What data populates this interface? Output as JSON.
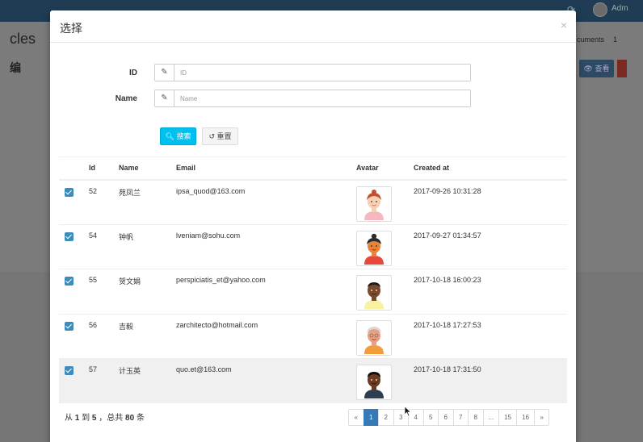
{
  "background": {
    "user_name": "Adm",
    "page_title": "cles",
    "page_subtitle": "编",
    "crumb": "cuments",
    "crumb_num": "1",
    "view_button": "查看"
  },
  "modal": {
    "title": "选择",
    "close": "×"
  },
  "filters": {
    "id_label": "ID",
    "id_placeholder": "ID",
    "name_label": "Name",
    "name_placeholder": "Name",
    "search_button": "搜索",
    "reset_button": "重置"
  },
  "table": {
    "headers": [
      "Id",
      "Name",
      "Email",
      "Avatar",
      "Created at"
    ],
    "rows": [
      {
        "id": "52",
        "name": "苑凤兰",
        "email": "ipsa_quod@163.com",
        "created_at": "2017-09-26 10:31:28",
        "avatar": "female-avatar-pink"
      },
      {
        "id": "54",
        "name": "钟帆",
        "email": "lveniam@sohu.com",
        "created_at": "2017-09-27 01:34:57",
        "avatar": "female-avatar-orange"
      },
      {
        "id": "55",
        "name": "贺文娟",
        "email": "perspiciatis_et@yahoo.com",
        "created_at": "2017-10-18 16:00:23",
        "avatar": "male-avatar-yellow"
      },
      {
        "id": "56",
        "name": "吉毅",
        "email": "zarchitecto@hotmail.com",
        "created_at": "2017-10-18 17:27:53",
        "avatar": "elder-avatar-orange"
      },
      {
        "id": "57",
        "name": "计玉英",
        "email": "quo.et@163.com",
        "created_at": "2017-10-18 17:31:50",
        "avatar": "male-avatar-dark"
      }
    ]
  },
  "summary": {
    "prefix": "从",
    "from": "1",
    "to_word": "到",
    "to": "5",
    "total_word": "，总共",
    "total": "80",
    "suffix": "条"
  },
  "pagination": [
    "«",
    "1",
    "2",
    "3",
    "4",
    "5",
    "6",
    "7",
    "8",
    "...",
    "15",
    "16",
    "»"
  ],
  "colors": {
    "accent": "#3c8dbc",
    "search_btn": "#00c0ef",
    "active_page": "#337ab7"
  }
}
